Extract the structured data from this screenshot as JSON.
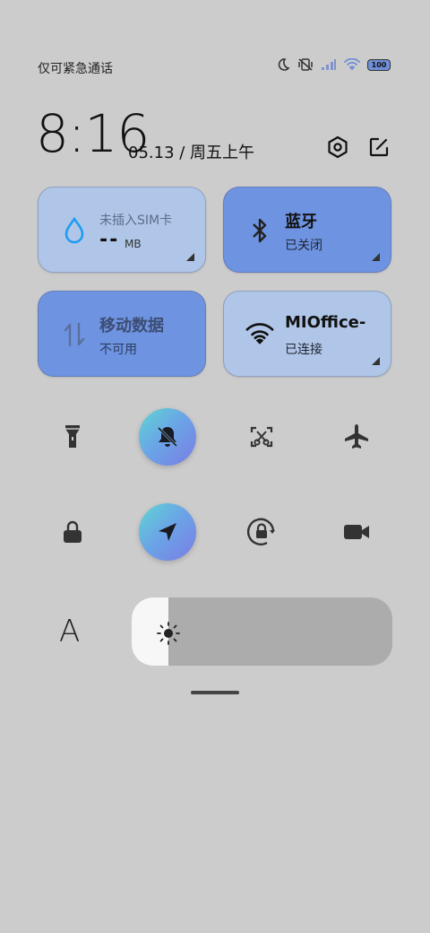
{
  "status_bar": {
    "carrier_text": "仅可紧急通话",
    "battery_level": "100",
    "icons": [
      "moon-icon",
      "vibrate-icon",
      "signal-icon",
      "wifi-icon",
      "battery-icon"
    ]
  },
  "header": {
    "time": "8:16",
    "date": "05.13 / 周五上午",
    "icons": [
      "settings-icon",
      "edit-icon"
    ]
  },
  "tiles": [
    {
      "title": "未插入SIM卡",
      "value": "--",
      "unit": "MB",
      "icon": "water-drop-icon",
      "state": "light"
    },
    {
      "title": "蓝牙",
      "subtitle": "已关闭",
      "icon": "bluetooth-icon",
      "state": "dark"
    },
    {
      "title": "移动数据",
      "subtitle": "不可用",
      "icon": "data-arrows-icon",
      "state": "dark"
    },
    {
      "title": "MIOffice-",
      "subtitle": "已连接",
      "icon": "wifi-icon",
      "state": "light"
    }
  ],
  "toggles_row1": [
    {
      "icon": "flashlight-icon",
      "active": false
    },
    {
      "icon": "mute-bell-icon",
      "active": true
    },
    {
      "icon": "screenshot-icon",
      "active": false
    },
    {
      "icon": "airplane-icon",
      "active": false
    }
  ],
  "toggles_row2": [
    {
      "icon": "lock-icon",
      "active": false
    },
    {
      "icon": "location-icon",
      "active": true
    },
    {
      "icon": "rotation-lock-icon",
      "active": false
    },
    {
      "icon": "video-camera-icon",
      "active": false
    }
  ],
  "brightness": {
    "auto_label": "A",
    "level_percent": 14
  },
  "colors": {
    "background": "#cccccc",
    "tile_light": "#b0c6e8",
    "tile_dark": "#6e93e0",
    "accent_gradient": [
      "#5fd6d2",
      "#7a7ce4"
    ]
  }
}
